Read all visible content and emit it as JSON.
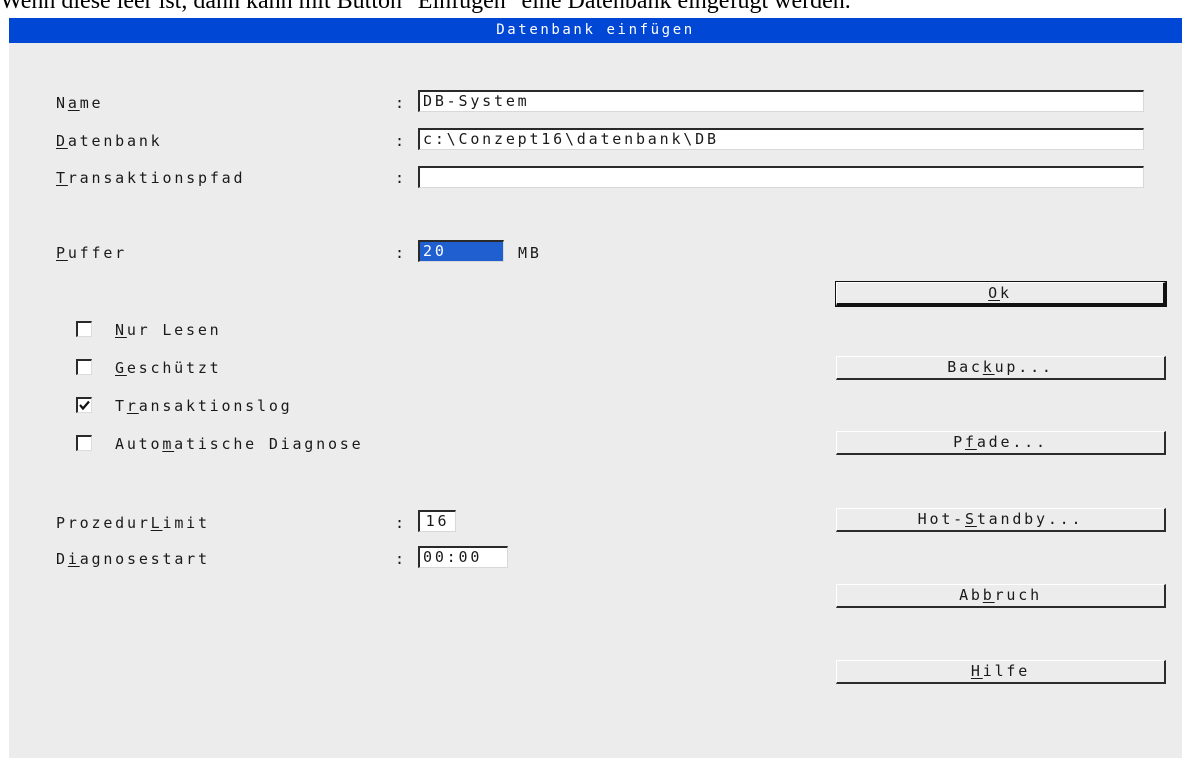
{
  "caption": "Wenn diese leer ist, dann kann mit Button \"Einfügen\" eine Datenbank eingefügt werden.",
  "window": {
    "title": "Datenbank einfügen"
  },
  "fields": {
    "name": {
      "label_pre": "N",
      "label_u": "a",
      "label_post": "me",
      "value": "DB-System"
    },
    "datenbank": {
      "label_pre": "",
      "label_u": "D",
      "label_post": "atenbank",
      "value": "c:\\Conzept16\\datenbank\\DB"
    },
    "transaktionspfad": {
      "label_pre": "",
      "label_u": "T",
      "label_post": "ransaktionspfad",
      "value": ""
    },
    "puffer": {
      "label_pre": "",
      "label_u": "P",
      "label_post": "uffer",
      "value": "20",
      "unit": "MB"
    },
    "prozedurlimit": {
      "label_pre": "Prozedur",
      "label_u": "L",
      "label_post": "imit",
      "value": "16"
    },
    "diagnosestart": {
      "label_pre": "D",
      "label_u": "i",
      "label_post": "agnosestart",
      "value": "00:00"
    }
  },
  "colon": ":",
  "checkboxes": [
    {
      "pre": "",
      "u": "N",
      "post": "ur Lesen",
      "checked": false
    },
    {
      "pre": "",
      "u": "G",
      "post": "eschützt",
      "checked": false
    },
    {
      "pre": "T",
      "u": "r",
      "post": "ansaktionslog",
      "checked": true
    },
    {
      "pre": "Auto",
      "u": "m",
      "post": "atische Diagnose",
      "checked": false
    }
  ],
  "buttons": {
    "ok": {
      "pre": "",
      "u": "O",
      "post": "k"
    },
    "backup": {
      "pre": "Bac",
      "u": "k",
      "post": "up..."
    },
    "pfade": {
      "pre": "P",
      "u": "f",
      "post": "ade..."
    },
    "hot_standby": {
      "pre": "Hot-",
      "u": "S",
      "post": "tandby..."
    },
    "abbruch": {
      "pre": "Ab",
      "u": "b",
      "post": "ruch"
    },
    "hilfe": {
      "pre": "",
      "u": "H",
      "post": "ilfe"
    }
  },
  "colors": {
    "titlebar": "#0047d6",
    "dialog_bg": "#ececec",
    "selection": "#1f5fd0"
  }
}
